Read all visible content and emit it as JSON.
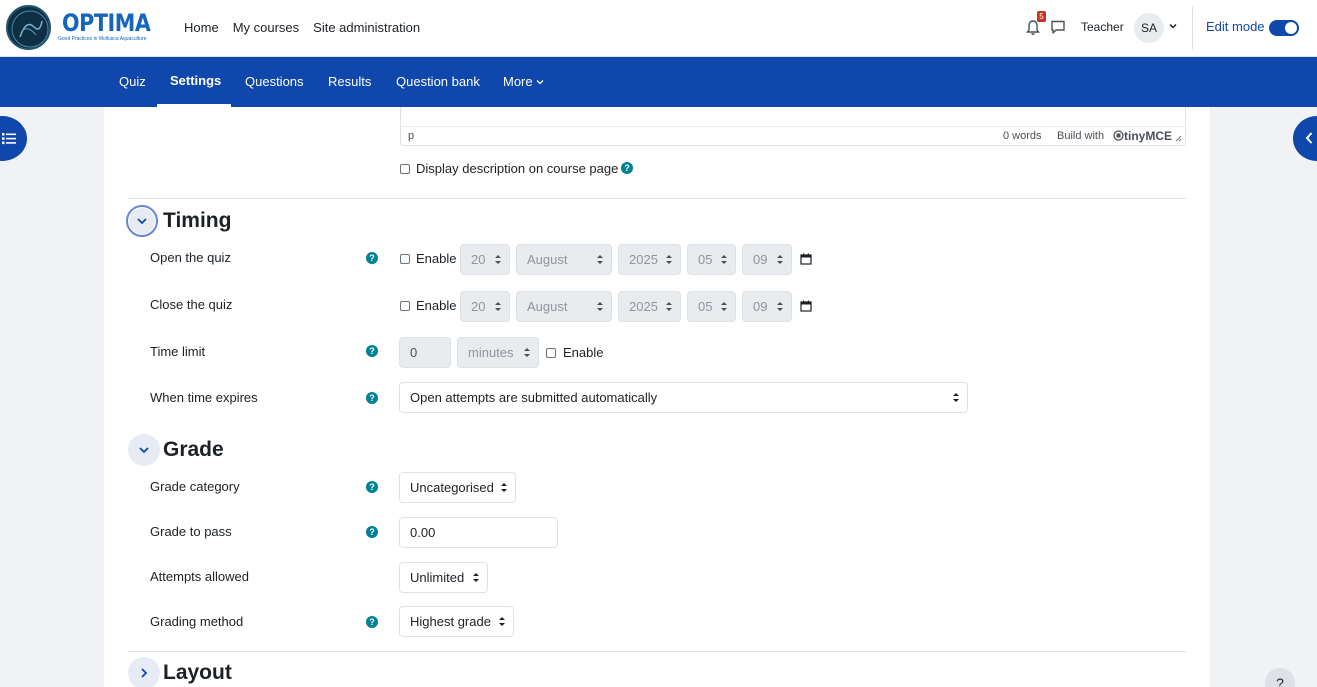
{
  "brand": {
    "name": "OPTIMA",
    "tagline": "Good Practices in Mollusca Aquaculture"
  },
  "primary_nav": [
    "Home",
    "My courses",
    "Site administration"
  ],
  "user": {
    "notification_count": "5",
    "role": "Teacher",
    "initials": "SA"
  },
  "edit_mode": {
    "label": "Edit mode",
    "on": true
  },
  "secondary_nav": {
    "tabs": [
      "Quiz",
      "Settings",
      "Questions",
      "Results",
      "Question bank"
    ],
    "more": "More",
    "active": "Settings"
  },
  "editor": {
    "path": "p",
    "words": "0 words",
    "build_with": "Build with",
    "brand": "tinyMCE"
  },
  "description": {
    "label": "Display description on course page"
  },
  "timing": {
    "title": "Timing",
    "open": {
      "label": "Open the quiz",
      "enable": "Enable",
      "day": "20",
      "month": "August",
      "year": "2025",
      "hour": "05",
      "minute": "09"
    },
    "close": {
      "label": "Close the quiz",
      "enable": "Enable",
      "day": "20",
      "month": "August",
      "year": "2025",
      "hour": "05",
      "minute": "09"
    },
    "time_limit": {
      "label": "Time limit",
      "value": "0",
      "unit": "minutes",
      "enable": "Enable"
    },
    "expires": {
      "label": "When time expires",
      "value": "Open attempts are submitted automatically"
    }
  },
  "grade": {
    "title": "Grade",
    "category": {
      "label": "Grade category",
      "value": "Uncategorised"
    },
    "to_pass": {
      "label": "Grade to pass",
      "value": "0.00"
    },
    "attempts": {
      "label": "Attempts allowed",
      "value": "Unlimited"
    },
    "method": {
      "label": "Grading method",
      "value": "Highest grade"
    }
  },
  "layout": {
    "title": "Layout"
  },
  "help_fab": "?",
  "colors": {
    "primary": "#0f47ad",
    "help": "#008196",
    "badge": "#ca3120"
  }
}
